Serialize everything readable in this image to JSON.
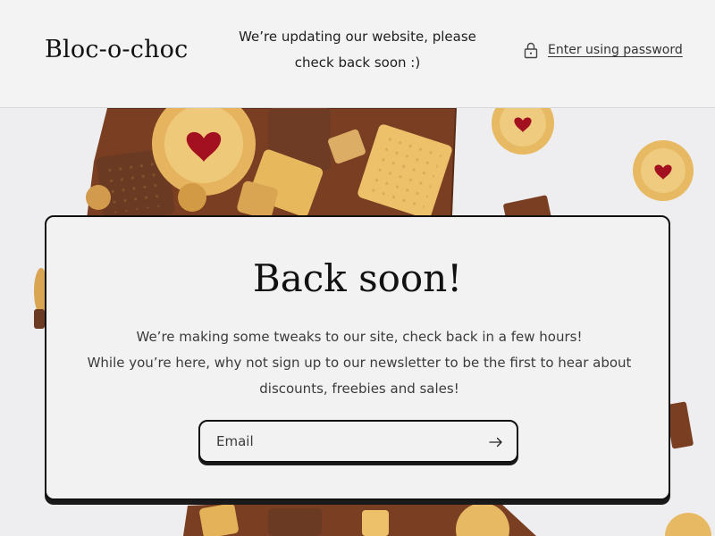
{
  "header": {
    "logo": "Bloc-o-choc",
    "notice_line1": "We’re updating our website, please",
    "notice_line2": "check back soon :)",
    "password_link": "Enter using password",
    "password_icon": "lock-icon"
  },
  "card": {
    "title": "Back soon!",
    "message_line1": "We’re making some tweaks to our site, check back in a few hours!",
    "message_line2": "While you’re here, why not sign up to our newsletter to be the first to hear about",
    "message_line3": "discounts, freebies and sales!",
    "email_placeholder": "Email",
    "email_value": "",
    "submit_icon": "arrow-right-icon"
  },
  "colors": {
    "background": "#f3f2f2",
    "text": "#111111",
    "biscuit": "#e6b45e",
    "chocolate": "#7a3f22",
    "jam": "#b3162a"
  }
}
